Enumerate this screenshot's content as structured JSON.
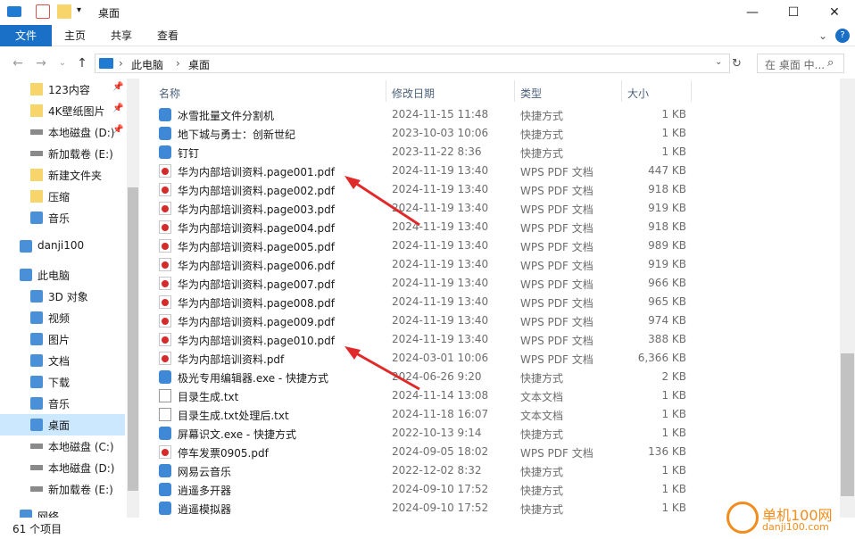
{
  "window": {
    "title": "桌面"
  },
  "ribbon": {
    "tabs": [
      "文件",
      "主页",
      "共享",
      "查看"
    ]
  },
  "address": {
    "path": [
      "此电脑",
      "桌面"
    ]
  },
  "search": {
    "placeholder": "在 桌面 中..."
  },
  "nav": {
    "items": [
      {
        "label": "123内容",
        "icon": "folder-icon",
        "pinned": true
      },
      {
        "label": "4K壁纸图片",
        "icon": "folder-icon",
        "pinned": true
      },
      {
        "label": "本地磁盘 (D:)",
        "icon": "drive-icon",
        "pinned": true
      },
      {
        "label": "新加载卷 (E:)",
        "icon": "drive-icon",
        "pinned": false
      },
      {
        "label": "新建文件夹",
        "icon": "folder-icon",
        "pinned": false
      },
      {
        "label": "压缩",
        "icon": "folder-icon",
        "pinned": false
      },
      {
        "label": "音乐",
        "icon": "music-icon",
        "pinned": false
      },
      {
        "label": "danji100",
        "icon": "cloud-icon",
        "pinned": false
      },
      {
        "label": "此电脑",
        "icon": "computer-icon",
        "pinned": false
      },
      {
        "label": "3D 对象",
        "icon": "3d-objects-icon",
        "pinned": false
      },
      {
        "label": "视频",
        "icon": "video-icon",
        "pinned": false
      },
      {
        "label": "图片",
        "icon": "pictures-icon",
        "pinned": false
      },
      {
        "label": "文档",
        "icon": "documents-icon",
        "pinned": false
      },
      {
        "label": "下载",
        "icon": "download-icon",
        "pinned": false
      },
      {
        "label": "音乐",
        "icon": "music-icon",
        "pinned": false
      },
      {
        "label": "桌面",
        "icon": "desktop-icon",
        "pinned": false,
        "selected": true
      },
      {
        "label": "本地磁盘 (C:)",
        "icon": "drive-icon",
        "pinned": false
      },
      {
        "label": "本地磁盘 (D:)",
        "icon": "drive-icon",
        "pinned": false
      },
      {
        "label": "新加载卷 (E:)",
        "icon": "drive-icon",
        "pinned": false
      },
      {
        "label": "网络",
        "icon": "network-icon",
        "pinned": false
      }
    ]
  },
  "columns": {
    "name": "名称",
    "date": "修改日期",
    "type": "类型",
    "size": "大小"
  },
  "files": [
    {
      "name": "冰雪批量文件分割机",
      "date": "2024-11-15 11:48",
      "type": "快捷方式",
      "size": "1 KB",
      "icon": "shortcut-icon"
    },
    {
      "name": "地下城与勇士：创新世纪",
      "date": "2023-10-03 10:06",
      "type": "快捷方式",
      "size": "1 KB",
      "icon": "shortcut-icon"
    },
    {
      "name": "钉钉",
      "date": "2023-11-22 8:36",
      "type": "快捷方式",
      "size": "1 KB",
      "icon": "shortcut-icon"
    },
    {
      "name": "华为内部培训资料.page001.pdf",
      "date": "2024-11-19 13:40",
      "type": "WPS PDF 文档",
      "size": "447 KB",
      "icon": "pdf-icon"
    },
    {
      "name": "华为内部培训资料.page002.pdf",
      "date": "2024-11-19 13:40",
      "type": "WPS PDF 文档",
      "size": "918 KB",
      "icon": "pdf-icon"
    },
    {
      "name": "华为内部培训资料.page003.pdf",
      "date": "2024-11-19 13:40",
      "type": "WPS PDF 文档",
      "size": "919 KB",
      "icon": "pdf-icon"
    },
    {
      "name": "华为内部培训资料.page004.pdf",
      "date": "2024-11-19 13:40",
      "type": "WPS PDF 文档",
      "size": "918 KB",
      "icon": "pdf-icon"
    },
    {
      "name": "华为内部培训资料.page005.pdf",
      "date": "2024-11-19 13:40",
      "type": "WPS PDF 文档",
      "size": "989 KB",
      "icon": "pdf-icon"
    },
    {
      "name": "华为内部培训资料.page006.pdf",
      "date": "2024-11-19 13:40",
      "type": "WPS PDF 文档",
      "size": "919 KB",
      "icon": "pdf-icon"
    },
    {
      "name": "华为内部培训资料.page007.pdf",
      "date": "2024-11-19 13:40",
      "type": "WPS PDF 文档",
      "size": "966 KB",
      "icon": "pdf-icon"
    },
    {
      "name": "华为内部培训资料.page008.pdf",
      "date": "2024-11-19 13:40",
      "type": "WPS PDF 文档",
      "size": "965 KB",
      "icon": "pdf-icon"
    },
    {
      "name": "华为内部培训资料.page009.pdf",
      "date": "2024-11-19 13:40",
      "type": "WPS PDF 文档",
      "size": "974 KB",
      "icon": "pdf-icon"
    },
    {
      "name": "华为内部培训资料.page010.pdf",
      "date": "2024-11-19 13:40",
      "type": "WPS PDF 文档",
      "size": "388 KB",
      "icon": "pdf-icon"
    },
    {
      "name": "华为内部培训资料.pdf",
      "date": "2024-03-01 10:06",
      "type": "WPS PDF 文档",
      "size": "6,366 KB",
      "icon": "pdf-icon"
    },
    {
      "name": "极光专用编辑器.exe - 快捷方式",
      "date": "2024-06-26 9:20",
      "type": "快捷方式",
      "size": "2 KB",
      "icon": "shortcut-icon"
    },
    {
      "name": "目录生成.txt",
      "date": "2024-11-14 13:08",
      "type": "文本文档",
      "size": "1 KB",
      "icon": "txt-icon"
    },
    {
      "name": "目录生成.txt处理后.txt",
      "date": "2024-11-18 16:07",
      "type": "文本文档",
      "size": "1 KB",
      "icon": "txt-icon"
    },
    {
      "name": "屏幕识文.exe - 快捷方式",
      "date": "2022-10-13 9:14",
      "type": "快捷方式",
      "size": "1 KB",
      "icon": "shortcut-icon"
    },
    {
      "name": "停车发票0905.pdf",
      "date": "2024-09-05 18:02",
      "type": "WPS PDF 文档",
      "size": "136 KB",
      "icon": "pdf-icon"
    },
    {
      "name": "网易云音乐",
      "date": "2022-12-02 8:32",
      "type": "快捷方式",
      "size": "1 KB",
      "icon": "shortcut-icon"
    },
    {
      "name": "逍遥多开器",
      "date": "2024-09-10 17:52",
      "type": "快捷方式",
      "size": "1 KB",
      "icon": "shortcut-icon"
    },
    {
      "name": "逍遥模拟器",
      "date": "2024-09-10 17:52",
      "type": "快捷方式",
      "size": "1 KB",
      "icon": "shortcut-icon"
    }
  ],
  "status": {
    "count": "61 个项目"
  },
  "watermark": {
    "name": "单机100网",
    "url": "danji100.com"
  },
  "colors": {
    "accent": "#1a6fc7",
    "selected": "#cce8ff",
    "arrow": "#e02a2a"
  }
}
